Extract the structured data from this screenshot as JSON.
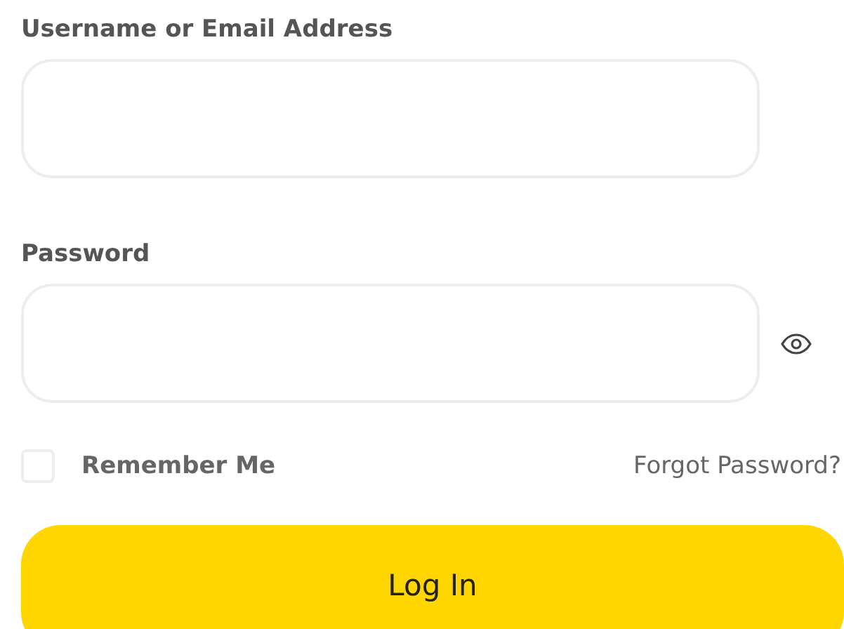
{
  "fields": [
    {
      "kind": "text",
      "label": "Username or Email Address"
    },
    {
      "kind": "password",
      "label": "Password"
    }
  ],
  "remember": {
    "label": "Remember Me",
    "checked": false
  },
  "forgot_link": "Forgot Password?",
  "submit": "Log In"
}
